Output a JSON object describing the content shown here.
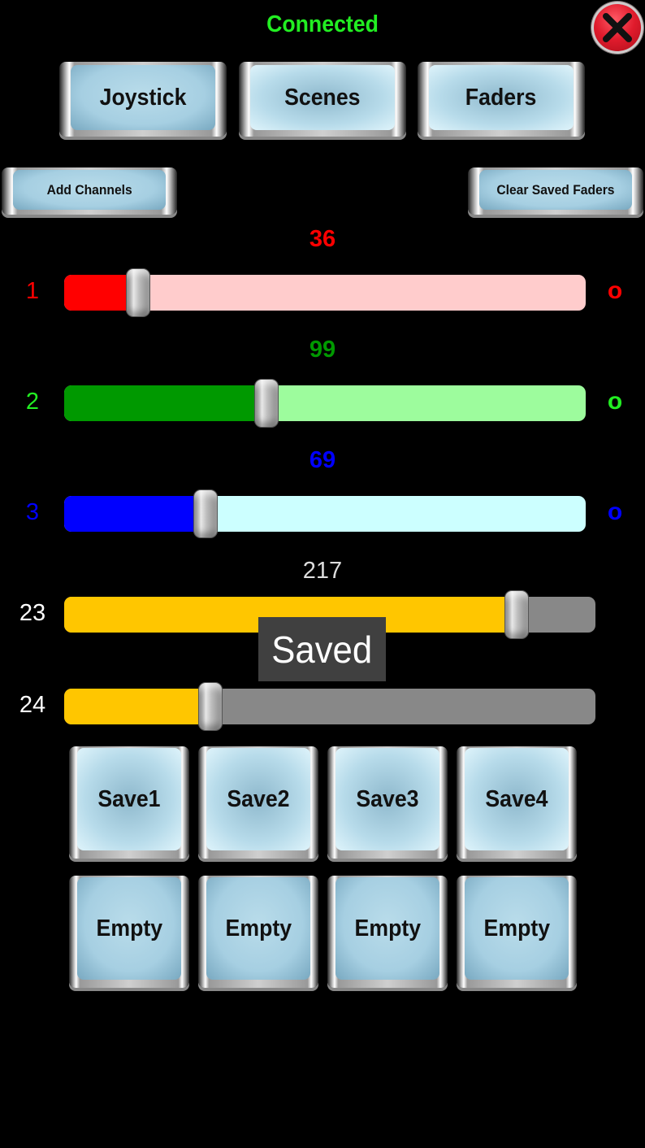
{
  "status": {
    "text": "Connected",
    "color": "#22ee22"
  },
  "close_button": {
    "icon": "close-x-icon"
  },
  "tabs": [
    {
      "label": "Joystick",
      "active": true
    },
    {
      "label": "Scenes",
      "active": false
    },
    {
      "label": "Faders",
      "active": false
    }
  ],
  "actions": {
    "add_channels": "Add Channels",
    "clear_saved_faders": "Clear Saved Faders"
  },
  "faders": [
    {
      "channel": "1",
      "value_label": "36",
      "value": 36,
      "max": 255,
      "right_label": "o",
      "color": "#ff0000",
      "fill_color": "#ff0000",
      "track_color": "#ffcccc",
      "label_color": "#ff0000"
    },
    {
      "channel": "2",
      "value_label": "99",
      "value": 99,
      "max": 255,
      "right_label": "o",
      "color": "#009900",
      "fill_color": "#009900",
      "track_color": "#9dfc9d",
      "label_color": "#22ee22"
    },
    {
      "channel": "3",
      "value_label": "69",
      "value": 69,
      "max": 255,
      "right_label": "o",
      "color": "#0000ff",
      "fill_color": "#0000ff",
      "track_color": "#ccffff",
      "label_color": "#0000ff"
    },
    {
      "channel": "23",
      "value_label": "217",
      "value": 217,
      "max": 255,
      "color": "#dddddd",
      "fill_color": "#ffc600",
      "track_color": "#888888",
      "label_color": "#ffffff"
    },
    {
      "channel": "24",
      "value_label": "",
      "value": 70,
      "max": 255,
      "color": "#dddddd",
      "fill_color": "#ffc600",
      "track_color": "#888888",
      "label_color": "#ffffff"
    }
  ],
  "toast": {
    "text": "Saved"
  },
  "save_buttons": [
    "Save1",
    "Save2",
    "Save3",
    "Save4"
  ],
  "slot_buttons": [
    "Empty",
    "Empty",
    "Empty",
    "Empty"
  ]
}
